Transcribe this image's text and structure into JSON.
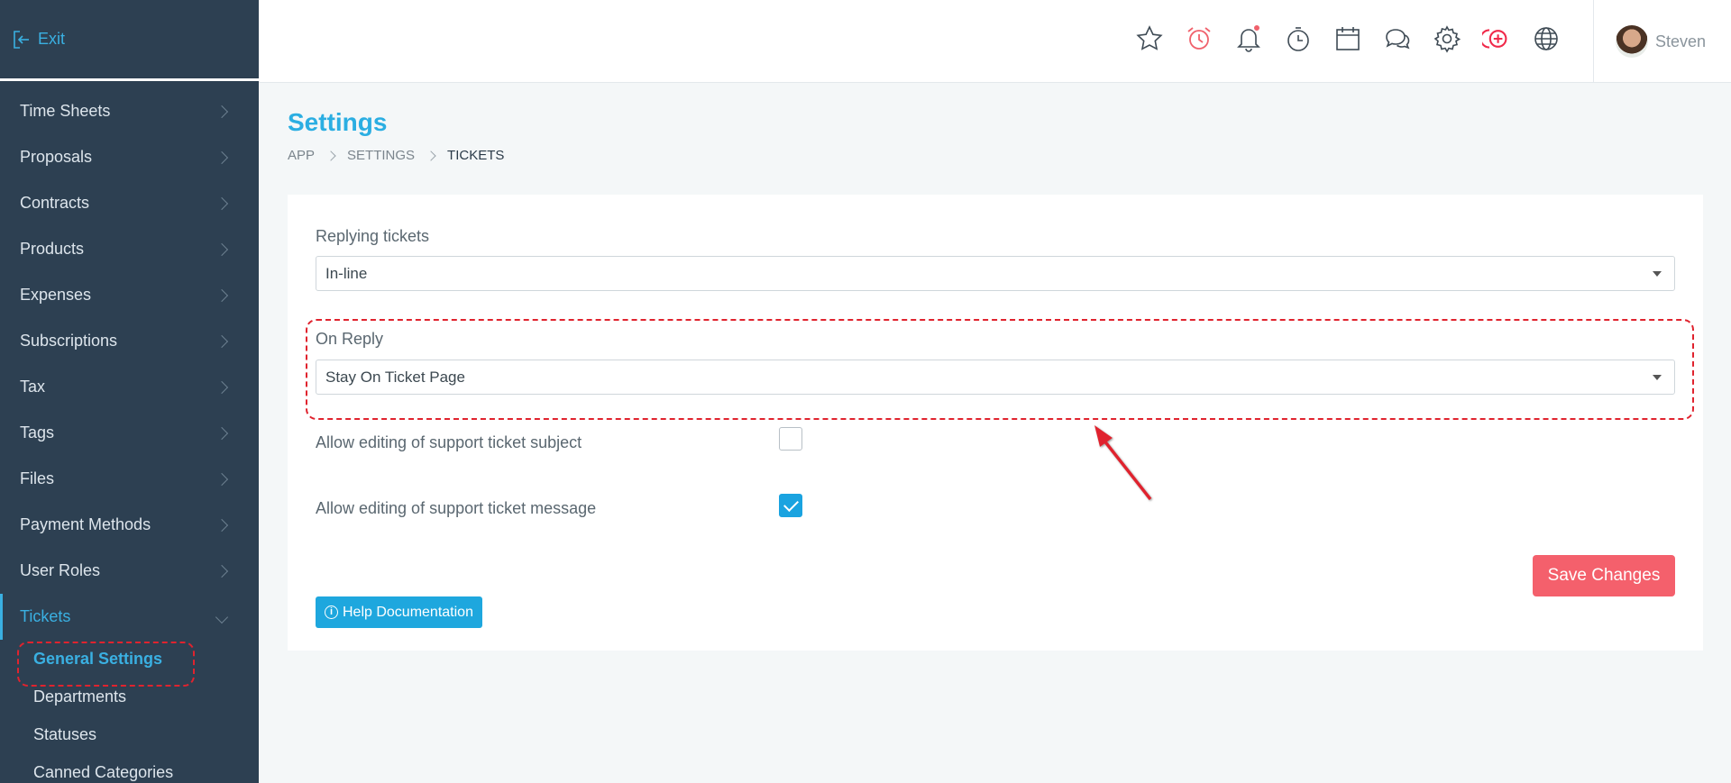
{
  "sidebar": {
    "exit_label": "Exit",
    "items": [
      {
        "label": "Time Sheets"
      },
      {
        "label": "Proposals"
      },
      {
        "label": "Contracts"
      },
      {
        "label": "Products"
      },
      {
        "label": "Expenses"
      },
      {
        "label": "Subscriptions"
      },
      {
        "label": "Tax"
      },
      {
        "label": "Tags"
      },
      {
        "label": "Files"
      },
      {
        "label": "Payment Methods"
      },
      {
        "label": "User Roles"
      },
      {
        "label": "Tickets"
      }
    ],
    "submenu": [
      {
        "label": "General Settings"
      },
      {
        "label": "Departments"
      },
      {
        "label": "Statuses"
      },
      {
        "label": "Canned Categories"
      }
    ]
  },
  "header": {
    "icons": [
      "star-icon",
      "alarm-clock-icon",
      "bell-icon",
      "stopwatch-icon",
      "calendar-icon",
      "chat-icon",
      "gear-icon",
      "add-circle-icon",
      "globe-icon"
    ],
    "user_name": "Steven"
  },
  "page": {
    "title": "Settings",
    "breadcrumb": [
      "APP",
      "SETTINGS",
      "TICKETS"
    ]
  },
  "form": {
    "replying_label": "Replying tickets",
    "replying_value": "In-line",
    "on_reply_label": "On Reply",
    "on_reply_value": "Stay On Ticket Page",
    "edit_subject_label": "Allow editing of support ticket subject",
    "edit_subject_checked": false,
    "edit_message_label": "Allow editing of support ticket message",
    "edit_message_checked": true,
    "save_label": "Save Changes",
    "help_label": "Help Documentation"
  },
  "colors": {
    "sidebar_bg": "#2d4052",
    "accent": "#2baee2",
    "save_button": "#f4606c",
    "annotation_red": "#e0232e"
  }
}
